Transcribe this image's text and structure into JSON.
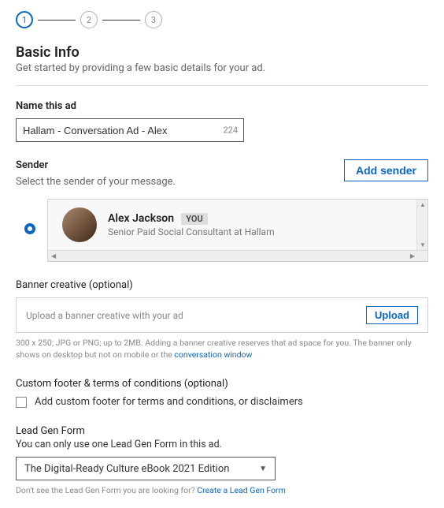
{
  "stepper": {
    "step1": "1",
    "step2": "2",
    "step3": "3"
  },
  "heading": "Basic Info",
  "subtitle": "Get started by providing a few basic details for your ad.",
  "name_field": {
    "label": "Name this ad",
    "value": "Hallam - Conversation Ad - Alex",
    "remaining": "224"
  },
  "sender": {
    "label": "Sender",
    "help": "Select the sender of your message.",
    "add_button": "Add sender",
    "name": "Alex Jackson",
    "you_tag": "YOU",
    "role": "Senior Paid Social Consultant at Hallam"
  },
  "banner": {
    "label": "Banner creative (optional)",
    "placeholder": "Upload a banner creative with your ad",
    "upload": "Upload",
    "fineprint_a": "300 x 250; JPG or PNG; up to 2MB. Adding a banner creative reserves that ad space for you. The banner only shows on desktop but not on mobile or the ",
    "fineprint_link": "conversation window"
  },
  "footer": {
    "label": "Custom footer & terms of conditions (optional)",
    "checkbox_label": "Add custom footer for terms and conditions, or disclaimers"
  },
  "leadgen": {
    "label": "Lead Gen Form",
    "help": "You can only use one Lead Gen Form in this ad.",
    "selected": "The Digital-Ready Culture eBook 2021 Edition",
    "fineprint": "Don't see the Lead Gen Form you are looking for? ",
    "create_link": "Create a Lead Gen Form"
  }
}
